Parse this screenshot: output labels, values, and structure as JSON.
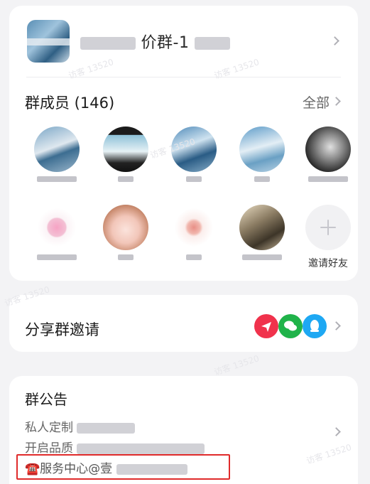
{
  "group": {
    "name_visible": "价群-1",
    "members_title": "群成员 (146)",
    "all_label": "全部",
    "invite_label": "邀请好友"
  },
  "share": {
    "title": "分享群邀请",
    "icons": [
      "send-icon",
      "wechat-icon",
      "qq-icon"
    ]
  },
  "notice": {
    "title": "群公告",
    "line1": "私人定制",
    "line2": "开启品质",
    "line3_prefix": "☎️",
    "line3": "服务中心@壹"
  },
  "watermark": "访客 13520",
  "colors": {
    "background": "#f3f3f5",
    "card": "#ffffff",
    "highlight_border": "#e02b2b",
    "share_red": "#f0324c",
    "share_green": "#20b34a",
    "share_blue": "#1ea8f3"
  }
}
